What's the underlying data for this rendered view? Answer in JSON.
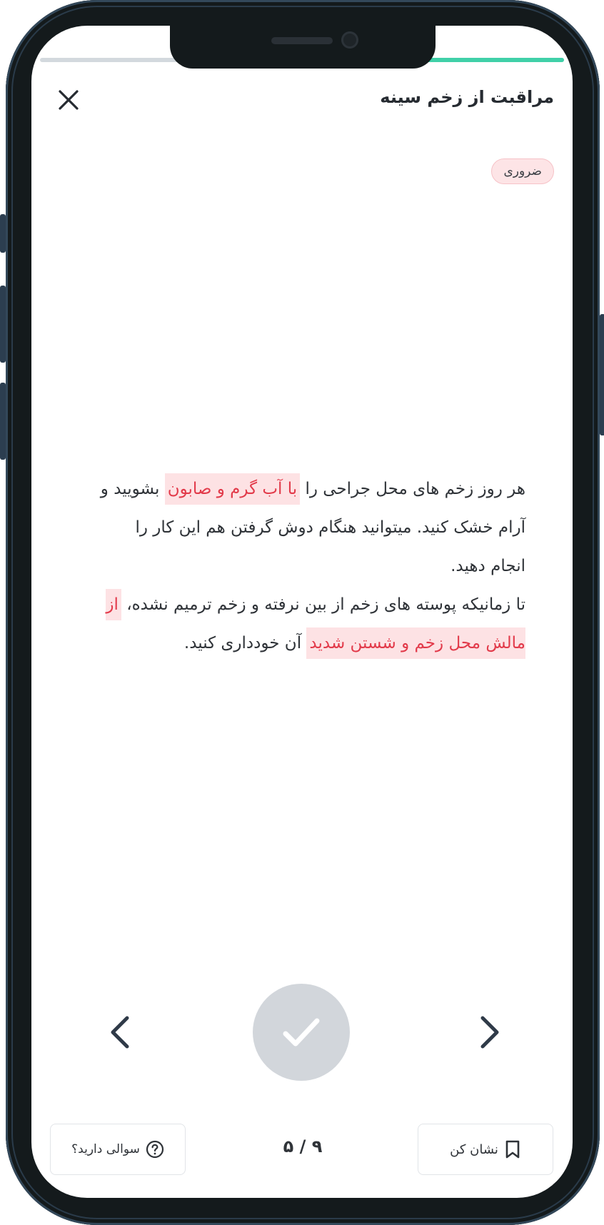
{
  "header": {
    "title": "مراقبت از زخم سینه",
    "close_icon": "close-icon"
  },
  "progress": {
    "fraction": 0.28,
    "track_color": "#d3d9de",
    "fill_color": "#40d0a8"
  },
  "badge": {
    "label": "ضروری"
  },
  "content": {
    "p1_before": "هر روز زخم های محل جراحی را",
    "p1_highlight": "با آب گرم و صابون",
    "p1_after": "بشویید و آرام خشک کنید. میتوانید هنگام دوش گرفتن هم این کار را انجام دهید.",
    "p2_before": "تا زمانیکه پوسته های زخم از بین نرفته و زخم ترمیم نشده،",
    "p2_highlight": "از مالش محل زخم و شستن شدید",
    "p2_after": "آن خودداری کنید.",
    "highlight_color": "#e23a4a"
  },
  "navigation": {
    "prev_icon": "chevron-left-icon",
    "next_icon": "chevron-right-icon",
    "done_icon": "check-icon"
  },
  "footer": {
    "bookmark_label": "نشان کن",
    "bookmark_icon": "bookmark-icon",
    "page_indicator": "۵ / ۹",
    "question_label": "سوالی دارید؟",
    "question_icon": "question-circle-icon"
  }
}
